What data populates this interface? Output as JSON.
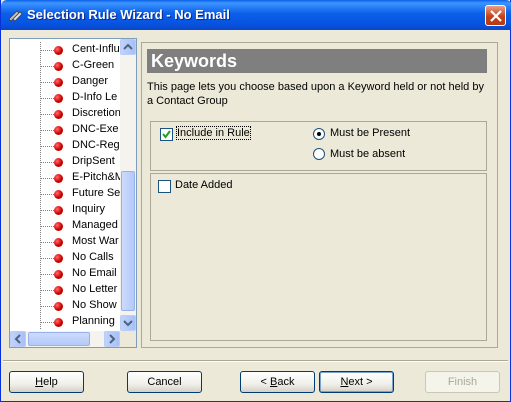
{
  "window": {
    "title": "Selection Rule Wizard - No Email"
  },
  "tree": {
    "items": [
      "Cent-Influ",
      "C-Green",
      "Danger",
      "D-Info Le",
      "Discretion",
      "DNC-Exe",
      "DNC-Reg",
      "DripSent",
      "E-Pitch&M",
      "Future Se",
      "Inquiry",
      "Managed",
      "Most War",
      "No Calls",
      "No Email",
      "No Letter",
      "No Show",
      "Planning"
    ]
  },
  "panel": {
    "title": "Keywords",
    "description": "This page lets you choose based upon a Keyword held or not held by a Contact Group",
    "include_label": "Include in Rule",
    "include_checked": true,
    "present_label": "Must be Present",
    "absent_label": "Must be absent",
    "selected_option": "present",
    "keywords": [
      {
        "label": "Date Added",
        "checked": false
      }
    ]
  },
  "buttons": {
    "help": "Help",
    "cancel": "Cancel",
    "back": "< Back",
    "next": "Next >",
    "finish": "Finish"
  }
}
